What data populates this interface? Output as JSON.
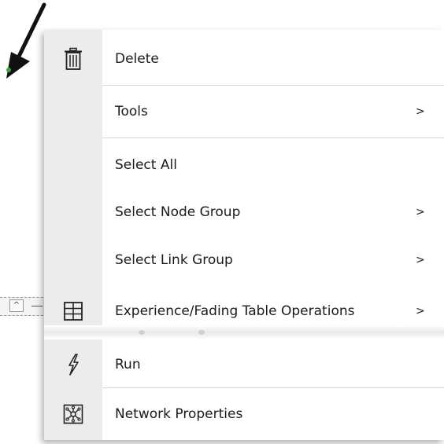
{
  "context_menu": {
    "items": [
      {
        "label": "Delete",
        "icon": "trash-icon",
        "submenu": false
      },
      {
        "label": "Tools",
        "icon": "",
        "submenu": true
      },
      {
        "label": "Select All",
        "icon": "",
        "submenu": false
      },
      {
        "label": "Select Node Group",
        "icon": "",
        "submenu": true
      },
      {
        "label": "Select Link Group",
        "icon": "",
        "submenu": true
      },
      {
        "label": "Experience/Fading Table Operations",
        "icon": "table-icon",
        "submenu": true
      },
      {
        "label": "Run",
        "icon": "lightning-icon",
        "submenu": false
      },
      {
        "label": "Network Properties",
        "icon": "network-icon",
        "submenu": false
      }
    ],
    "submenu_arrow": ">"
  },
  "background": {
    "scroll_caret": "^"
  }
}
